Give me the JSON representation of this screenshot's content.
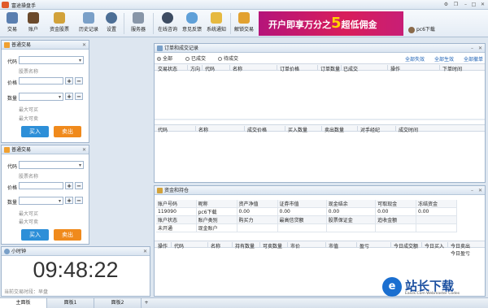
{
  "window": {
    "title": "富途操盘手"
  },
  "toolbar": {
    "items": [
      "交易",
      "账户",
      "资金股票",
      "历史记录",
      "设置",
      "服务器",
      "在线咨询",
      "意见反馈",
      "系统通知",
      "解锁交易"
    ]
  },
  "banner": {
    "text_a": "开户即享万分之",
    "text_five": "5",
    "text_b": "超低佣金"
  },
  "user": {
    "name": "pc6下载"
  },
  "trade1": {
    "title": "普通交易",
    "code_label": "代码",
    "stock_name_label": "股票名称",
    "price_label": "价格",
    "qty_label": "数量",
    "max_buy": "最大可买",
    "max_sell": "最大可卖",
    "buy": "买入",
    "sell": "卖出"
  },
  "trade2": {
    "title": "普通交易",
    "code_label": "代码",
    "stock_name_label": "股票名称",
    "price_label": "价格",
    "qty_label": "数量",
    "max_buy": "最大可买",
    "max_sell": "最大可卖",
    "buy": "买入",
    "sell": "卖出"
  },
  "clock": {
    "title": "小时钟",
    "time": "09:48:22",
    "session": "当前交易时段：早盘"
  },
  "orders": {
    "title": "订单和成交记录",
    "filters": [
      "全部",
      "已成交",
      "待成交"
    ],
    "actions": [
      "全部失效",
      "全部生效",
      "全部撤单"
    ],
    "columns": [
      "交易状态",
      "方向",
      "代码",
      "名称",
      "订单价格",
      "订单数量",
      "已成交",
      "操作",
      "下单时间"
    ],
    "deal_columns": [
      "代码",
      "名称",
      "成交价格",
      "买入数量",
      "卖出数量",
      "对手经纪",
      "成交时间"
    ]
  },
  "account": {
    "title": "资金和持仓",
    "row1_labels": [
      "账户号码",
      "昵称",
      "资产净值",
      "证券市值",
      "现金结余",
      "可取现金",
      "冻结资金"
    ],
    "row1_values": [
      "119090",
      "pc6下载",
      "0.00",
      "0.00",
      "0.00",
      "0.00",
      "0.00"
    ],
    "row2_labels": [
      "账户状态",
      "账户类别",
      "购买力",
      "最高信贷额",
      "股票保证金",
      "追收金额"
    ],
    "row2_values": [
      "未开通",
      "现金账户"
    ],
    "pos_columns": [
      "操作",
      "代码",
      "名称",
      "持有数量",
      "可卖数量",
      "市价",
      "市值",
      "盈亏",
      "今日成交额",
      "今日买入",
      "今日卖出",
      "今日盈亏"
    ]
  },
  "tabs": [
    "主面板",
    "面板1",
    "面板2",
    "+"
  ],
  "watermark": {
    "title": "站长下载",
    "url": "Easck.Com Webmaster Codes"
  },
  "colors": {
    "buy": "#2d8fd8",
    "sell": "#f08a1c",
    "banner": "#d81e5b"
  }
}
